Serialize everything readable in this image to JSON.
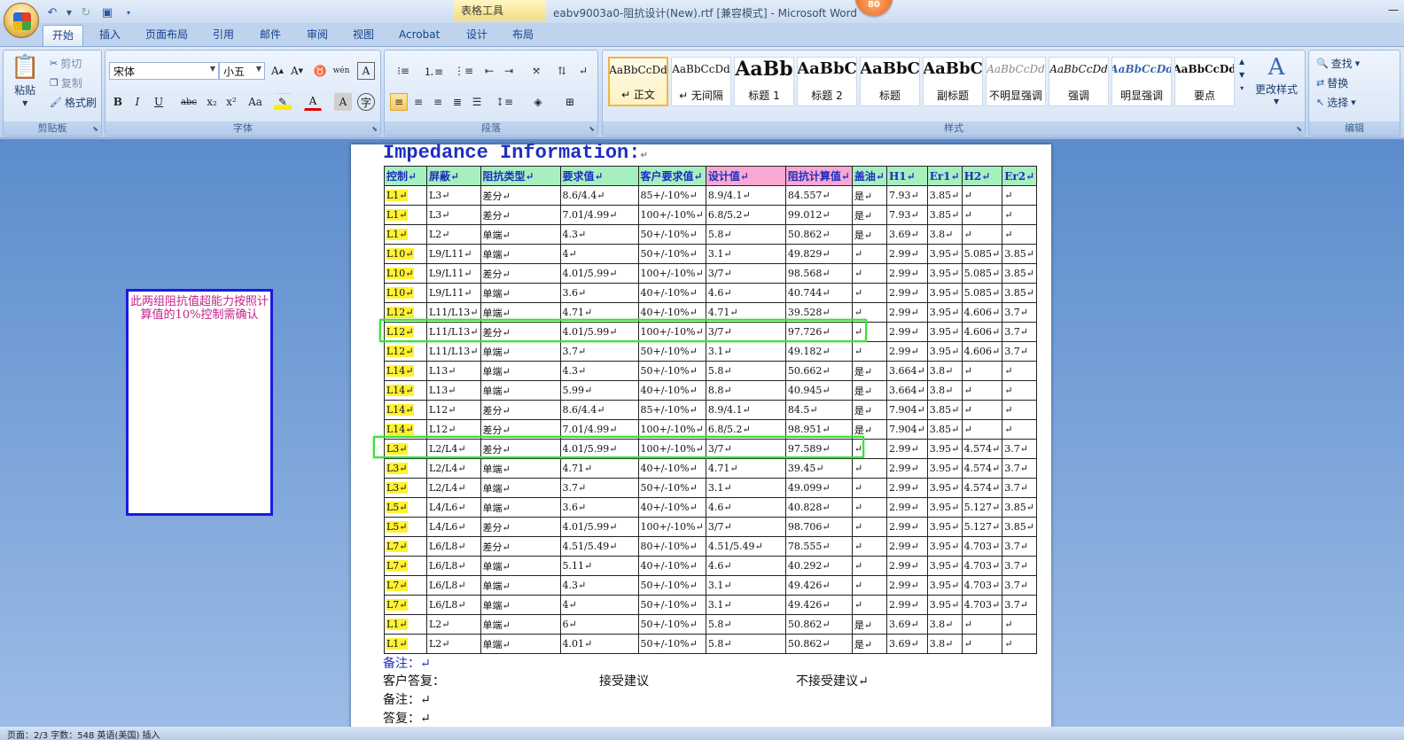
{
  "titlebar": {
    "contextual_tab_group": "表格工具",
    "window_title": "eabv9003a0-阻抗设计(New).rtf [兼容模式] - Microsoft Word",
    "badge": "80"
  },
  "tabs": [
    "开始",
    "插入",
    "页面布局",
    "引用",
    "邮件",
    "审阅",
    "视图",
    "Acrobat",
    "设计",
    "布局"
  ],
  "ribbon": {
    "clipboard": {
      "label": "剪贴板",
      "paste": "粘贴",
      "cut": "剪切",
      "copy": "复制",
      "format_painter": "格式刷"
    },
    "font": {
      "label": "字体",
      "font_name": "宋体",
      "font_size": "小五",
      "phonetic": "wén",
      "font_btns": [
        "B",
        "I",
        "U",
        "abc",
        "x₂",
        "x²",
        "Aa"
      ]
    },
    "paragraph": {
      "label": "段落"
    },
    "styles": {
      "label": "样式",
      "change_styles": "更改样式",
      "items": [
        {
          "sample": "AaBbCcDd",
          "name": "↵ 正文"
        },
        {
          "sample": "AaBbCcDd",
          "name": "↵ 无间隔"
        },
        {
          "sample": "AaBb",
          "name": "标题 1"
        },
        {
          "sample": "AaBbC",
          "name": "标题 2"
        },
        {
          "sample": "AaBbC",
          "name": "标题"
        },
        {
          "sample": "AaBbC",
          "name": "副标题"
        },
        {
          "sample": "AaBbCcDd",
          "name": "不明显强调"
        },
        {
          "sample": "AaBbCcDd",
          "name": "强调"
        },
        {
          "sample": "AaBbCcDd",
          "name": "明显强调"
        },
        {
          "sample": "AaBbCcDd",
          "name": "要点"
        }
      ]
    },
    "editing": {
      "label": "编辑",
      "find": "查找",
      "replace": "替换",
      "select": "选择"
    }
  },
  "comment": "此两组阻抗值超能力按照计算值的10%控制需确认",
  "document": {
    "title": "Impedance Information:",
    "table_headers": [
      "控制↵",
      "屏蔽↵",
      "阻抗类型↵",
      "要求值↵",
      "客户要求值↵",
      "设计值↵",
      "阻抗计算值↵",
      "盖油↵",
      "H1↵",
      "Er1↵",
      "H2↵",
      "Er2↵"
    ],
    "rows": [
      [
        "L1↵",
        "L3↵",
        "差分↵",
        "8.6/4.4↵",
        "85+/-10%↵",
        "8.9/4.1↵",
        "84.557↵",
        "是↵",
        "7.93↵",
        "3.85↵",
        "↵",
        "↵"
      ],
      [
        "L1↵",
        "L3↵",
        "差分↵",
        "7.01/4.99↵",
        "100+/-10%↵",
        "6.8/5.2↵",
        "99.012↵",
        "是↵",
        "7.93↵",
        "3.85↵",
        "↵",
        "↵"
      ],
      [
        "L1↵",
        "L2↵",
        "单端↵",
        "4.3↵",
        "50+/-10%↵",
        "5.8↵",
        "50.862↵",
        "是↵",
        "3.69↵",
        "3.8↵",
        "↵",
        "↵"
      ],
      [
        "L10↵",
        "L9/L11↵",
        "单端↵",
        "4↵",
        "50+/-10%↵",
        "3.1↵",
        "49.829↵",
        "↵",
        "2.99↵",
        "3.95↵",
        "5.085↵",
        "3.85↵"
      ],
      [
        "L10↵",
        "L9/L11↵",
        "差分↵",
        "4.01/5.99↵",
        "100+/-10%↵",
        "3/7↵",
        "98.568↵",
        "↵",
        "2.99↵",
        "3.95↵",
        "5.085↵",
        "3.85↵"
      ],
      [
        "L10↵",
        "L9/L11↵",
        "单端↵",
        "3.6↵",
        "40+/-10%↵",
        "4.6↵",
        "40.744↵",
        "↵",
        "2.99↵",
        "3.95↵",
        "5.085↵",
        "3.85↵"
      ],
      [
        "L12↵",
        "L11/L13↵",
        "单端↵",
        "4.71↵",
        "40+/-10%↵",
        "4.71↵",
        "39.528↵",
        "↵",
        "2.99↵",
        "3.95↵",
        "4.606↵",
        "3.7↵"
      ],
      [
        "L12↵",
        "L11/L13↵",
        "差分↵",
        "4.01/5.99↵",
        "100+/-10%↵",
        "3/7↵",
        "97.726↵",
        "↵",
        "2.99↵",
        "3.95↵",
        "4.606↵",
        "3.7↵"
      ],
      [
        "L12↵",
        "L11/L13↵",
        "单端↵",
        "3.7↵",
        "50+/-10%↵",
        "3.1↵",
        "49.182↵",
        "↵",
        "2.99↵",
        "3.95↵",
        "4.606↵",
        "3.7↵"
      ],
      [
        "L14↵",
        "L13↵",
        "单端↵",
        "4.3↵",
        "50+/-10%↵",
        "5.8↵",
        "50.662↵",
        "是↵",
        "3.664↵",
        "3.8↵",
        "↵",
        "↵"
      ],
      [
        "L14↵",
        "L13↵",
        "单端↵",
        "5.99↵",
        "40+/-10%↵",
        "8.8↵",
        "40.945↵",
        "是↵",
        "3.664↵",
        "3.8↵",
        "↵",
        "↵"
      ],
      [
        "L14↵",
        "L12↵",
        "差分↵",
        "8.6/4.4↵",
        "85+/-10%↵",
        "8.9/4.1↵",
        "84.5↵",
        "是↵",
        "7.904↵",
        "3.85↵",
        "↵",
        "↵"
      ],
      [
        "L14↵",
        "L12↵",
        "差分↵",
        "7.01/4.99↵",
        "100+/-10%↵",
        "6.8/5.2↵",
        "98.951↵",
        "是↵",
        "7.904↵",
        "3.85↵",
        "↵",
        "↵"
      ],
      [
        "L3↵",
        "L2/L4↵",
        "差分↵",
        "4.01/5.99↵",
        "100+/-10%↵",
        "3/7↵",
        "97.589↵",
        "↵",
        "2.99↵",
        "3.95↵",
        "4.574↵",
        "3.7↵"
      ],
      [
        "L3↵",
        "L2/L4↵",
        "单端↵",
        "4.71↵",
        "40+/-10%↵",
        "4.71↵",
        "39.45↵",
        "↵",
        "2.99↵",
        "3.95↵",
        "4.574↵",
        "3.7↵"
      ],
      [
        "L3↵",
        "L2/L4↵",
        "单端↵",
        "3.7↵",
        "50+/-10%↵",
        "3.1↵",
        "49.099↵",
        "↵",
        "2.99↵",
        "3.95↵",
        "4.574↵",
        "3.7↵"
      ],
      [
        "L5↵",
        "L4/L6↵",
        "单端↵",
        "3.6↵",
        "40+/-10%↵",
        "4.6↵",
        "40.828↵",
        "↵",
        "2.99↵",
        "3.95↵",
        "5.127↵",
        "3.85↵"
      ],
      [
        "L5↵",
        "L4/L6↵",
        "差分↵",
        "4.01/5.99↵",
        "100+/-10%↵",
        "3/7↵",
        "98.706↵",
        "↵",
        "2.99↵",
        "3.95↵",
        "5.127↵",
        "3.85↵"
      ],
      [
        "L7↵",
        "L6/L8↵",
        "差分↵",
        "4.51/5.49↵",
        "80+/-10%↵",
        "4.51/5.49↵",
        "78.555↵",
        "↵",
        "2.99↵",
        "3.95↵",
        "4.703↵",
        "3.7↵"
      ],
      [
        "L7↵",
        "L6/L8↵",
        "单端↵",
        "5.11↵",
        "40+/-10%↵",
        "4.6↵",
        "40.292↵",
        "↵",
        "2.99↵",
        "3.95↵",
        "4.703↵",
        "3.7↵"
      ],
      [
        "L7↵",
        "L6/L8↵",
        "单端↵",
        "4.3↵",
        "50+/-10%↵",
        "3.1↵",
        "49.426↵",
        "↵",
        "2.99↵",
        "3.95↵",
        "4.703↵",
        "3.7↵"
      ],
      [
        "L7↵",
        "L6/L8↵",
        "单端↵",
        "4↵",
        "50+/-10%↵",
        "3.1↵",
        "49.426↵",
        "↵",
        "2.99↵",
        "3.95↵",
        "4.703↵",
        "3.7↵"
      ],
      [
        "L1↵",
        "L2↵",
        "单端↵",
        "6↵",
        "50+/-10%↵",
        "5.8↵",
        "50.862↵",
        "是↵",
        "3.69↵",
        "3.8↵",
        "↵",
        "↵"
      ],
      [
        "L1↵",
        "L2↵",
        "单端↵",
        "4.01↵",
        "50+/-10%↵",
        "5.8↵",
        "50.862↵",
        "是↵",
        "3.69↵",
        "3.8↵",
        "↵",
        "↵"
      ]
    ],
    "footer": {
      "remark1": "备注：↵",
      "customer_reply": "客户答复：",
      "accept": "接受建议",
      "reject": "不接受建议↵",
      "remark2": "备注：↵",
      "reply": "答复：↵"
    }
  },
  "statusbar": {
    "text": "页面：2/3   字数：548   英语(美国)   插入"
  },
  "colors": {
    "control_highlight": "#fff233",
    "header_green": "#a6f0c0",
    "header_pink": "#f8a8d2",
    "highlight_box": "#3be03b",
    "comment_border": "#1a1adf"
  }
}
